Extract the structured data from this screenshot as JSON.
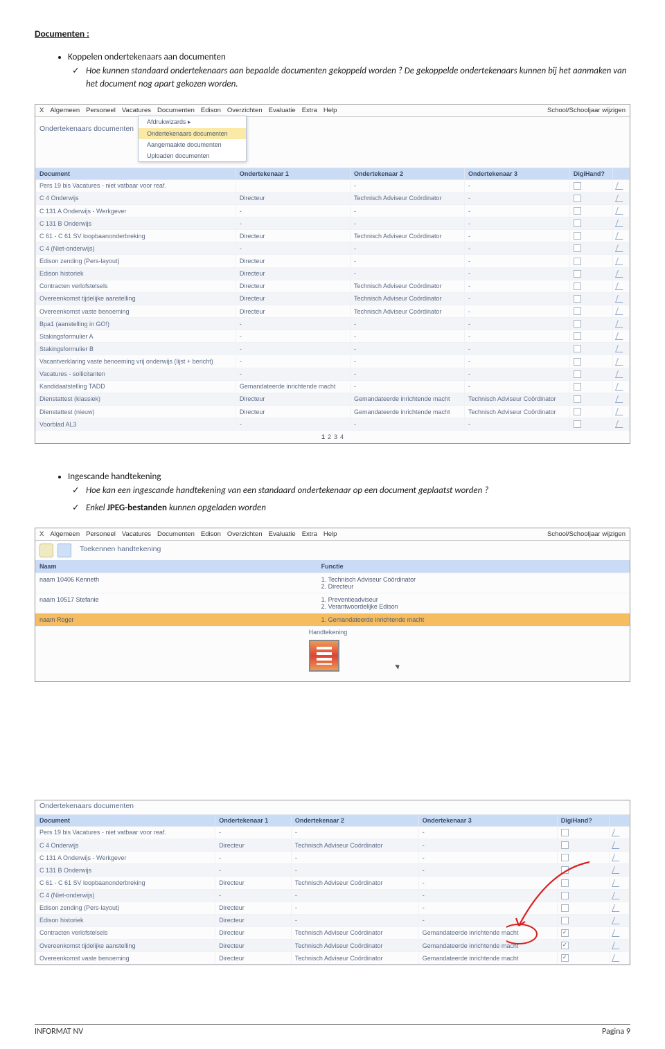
{
  "doc": {
    "section_title": "Documenten :",
    "bullet1": "Koppelen ondertekenaars aan documenten",
    "b1_sub1": "Hoe kunnen standaard ondertekenaars aan bepaalde documenten gekoppeld worden ? De gekoppelde ondertekenaars kunnen bij het aanmaken van het document nog apart gekozen worden.",
    "bullet2": "Ingescande handtekening",
    "b2_sub1": "Hoe kan een ingescande handtekening van een standaard ondertekenaar op een document geplaatst worden ?",
    "b2_sub2_pre": "Enkel ",
    "b2_sub2_bold": "JPEG-bestanden",
    "b2_sub2_post": " kunnen opgeladen worden",
    "footer_left": "INFORMAT  NV",
    "footer_right": "Pagina 9"
  },
  "menu": {
    "items": [
      "X",
      "Algemeen",
      "Personeel",
      "Vacatures",
      "Documenten",
      "Edison",
      "Overzichten",
      "Evaluatie",
      "Extra",
      "Help"
    ],
    "right": "School/Schooljaar wijzigen",
    "dropdown": [
      "Afdrukwizards",
      "Ondertekenaars documenten",
      "Aangemaakte documenten",
      "Uploaden documenten"
    ],
    "dropdown_arrow": "▸"
  },
  "shot1": {
    "subtitle": "Ondertekenaars documenten",
    "cols": [
      "Document",
      "Ondertekenaar 1",
      "Ondertekenaar 2",
      "Ondertekenaar 3",
      "DigiHand?",
      ""
    ],
    "rows": [
      [
        "Pers 19 bis Vacatures - niet vatbaar voor reaf.",
        "",
        "-",
        "-",
        "",
        ""
      ],
      [
        "C 4 Onderwijs",
        "Directeur",
        "Technisch Adviseur Coördinator",
        "-",
        "",
        ""
      ],
      [
        "C 131 A Onderwijs - Werkgever",
        "-",
        "-",
        "-",
        "",
        ""
      ],
      [
        "C 131 B Onderwijs",
        "-",
        "-",
        "-",
        "",
        ""
      ],
      [
        "C 61 - C 61 SV loopbaanonderbreking",
        "Directeur",
        "Technisch Adviseur Coördinator",
        "-",
        "",
        ""
      ],
      [
        "C 4 (Niet-onderwijs)",
        "-",
        "-",
        "-",
        "",
        ""
      ],
      [
        "Edison zending (Pers-layout)",
        "Directeur",
        "-",
        "-",
        "",
        ""
      ],
      [
        "Edison historiek",
        "Directeur",
        "-",
        "-",
        "",
        ""
      ],
      [
        "Contracten verlofstelsels",
        "Directeur",
        "Technisch Adviseur Coördinator",
        "-",
        "",
        ""
      ],
      [
        "Overeenkomst tijdelijke aanstelling",
        "Directeur",
        "Technisch Adviseur Coördinator",
        "-",
        "",
        ""
      ],
      [
        "Overeenkomst vaste benoeming",
        "Directeur",
        "Technisch Adviseur Coördinator",
        "-",
        "",
        ""
      ],
      [
        "Bpa1 (aanstelling in GO!)",
        "-",
        "-",
        "-",
        "",
        ""
      ],
      [
        "Stakingsformulier A",
        "-",
        "-",
        "-",
        "",
        ""
      ],
      [
        "Stakingsformulier B",
        "-",
        "-",
        "-",
        "",
        ""
      ],
      [
        "Vacantverklaring vaste benoeming vrij onderwijs (lijst + bericht)",
        "-",
        "-",
        "-",
        "",
        ""
      ],
      [
        "Vacatures - sollicitanten",
        "-",
        "-",
        "-",
        "",
        ""
      ],
      [
        "Kandidaatstelling TADD",
        "Gemandateerde inrichtende macht",
        "-",
        "-",
        "",
        ""
      ],
      [
        "Dienstattest (klassiek)",
        "Directeur",
        "Gemandateerde inrichtende macht",
        "Technisch Adviseur Coördinator",
        "",
        ""
      ],
      [
        "Dienstattest (nieuw)",
        "Directeur",
        "Gemandateerde inrichtende macht",
        "Technisch Adviseur Coördinator",
        "",
        ""
      ],
      [
        "Voorblad AL3",
        "-",
        "-",
        "-",
        "",
        ""
      ]
    ],
    "pager": [
      "1",
      "2",
      "3",
      "4"
    ]
  },
  "shot2": {
    "subtitle": "Toekennen handtekening",
    "cols": [
      "Naam",
      "Functie"
    ],
    "rows": [
      [
        "naam 10406 Kenneth",
        "1. Technisch Adviseur Coördinator\n2. Directeur"
      ],
      [
        "naam 10517 Stefanie",
        "1. Preventieadviseur\n2. Verantwoordelijke Edison"
      ],
      [
        "naam Roger",
        "1. Gemandateerde inrichtende macht"
      ]
    ],
    "sig_label": "Handtekening"
  },
  "shot3": {
    "subtitle": "Ondertekenaars documenten",
    "cols": [
      "Document",
      "Ondertekenaar 1",
      "Ondertekenaar 2",
      "Ondertekenaar 3",
      "DigiHand?",
      ""
    ],
    "rows": [
      [
        "Pers 19 bis Vacatures - niet vatbaar voor reaf.",
        "-",
        "-",
        "-",
        "",
        ""
      ],
      [
        "C 4 Onderwijs",
        "Directeur",
        "Technisch Adviseur Coördinator",
        "-",
        "",
        ""
      ],
      [
        "C 131 A Onderwijs - Werkgever",
        "-",
        "-",
        "-",
        "",
        ""
      ],
      [
        "C 131 B Onderwijs",
        "-",
        "-",
        "-",
        "",
        ""
      ],
      [
        "C 61 - C 61 SV loopbaanonderbreking",
        "Directeur",
        "Technisch Adviseur Coördinator",
        "-",
        "",
        ""
      ],
      [
        "C 4 (Niet-onderwijs)",
        "-",
        "-",
        "-",
        "",
        ""
      ],
      [
        "Edison zending (Pers-layout)",
        "Directeur",
        "-",
        "-",
        "",
        ""
      ],
      [
        "Edison historiek",
        "Directeur",
        "-",
        "-",
        "",
        ""
      ],
      [
        "Contracten verlofstelsels",
        "Directeur",
        "Technisch Adviseur Coördinator",
        "Gemandateerde inrichtende macht",
        "chk",
        ""
      ],
      [
        "Overeenkomst tijdelijke aanstelling",
        "Directeur",
        "Technisch Adviseur Coördinator",
        "Gemandateerde inrichtende macht",
        "chk",
        ""
      ],
      [
        "Overeenkomst vaste benoeming",
        "Directeur",
        "Technisch Adviseur Coördinator",
        "Gemandateerde inrichtende macht",
        "chk",
        ""
      ]
    ]
  }
}
